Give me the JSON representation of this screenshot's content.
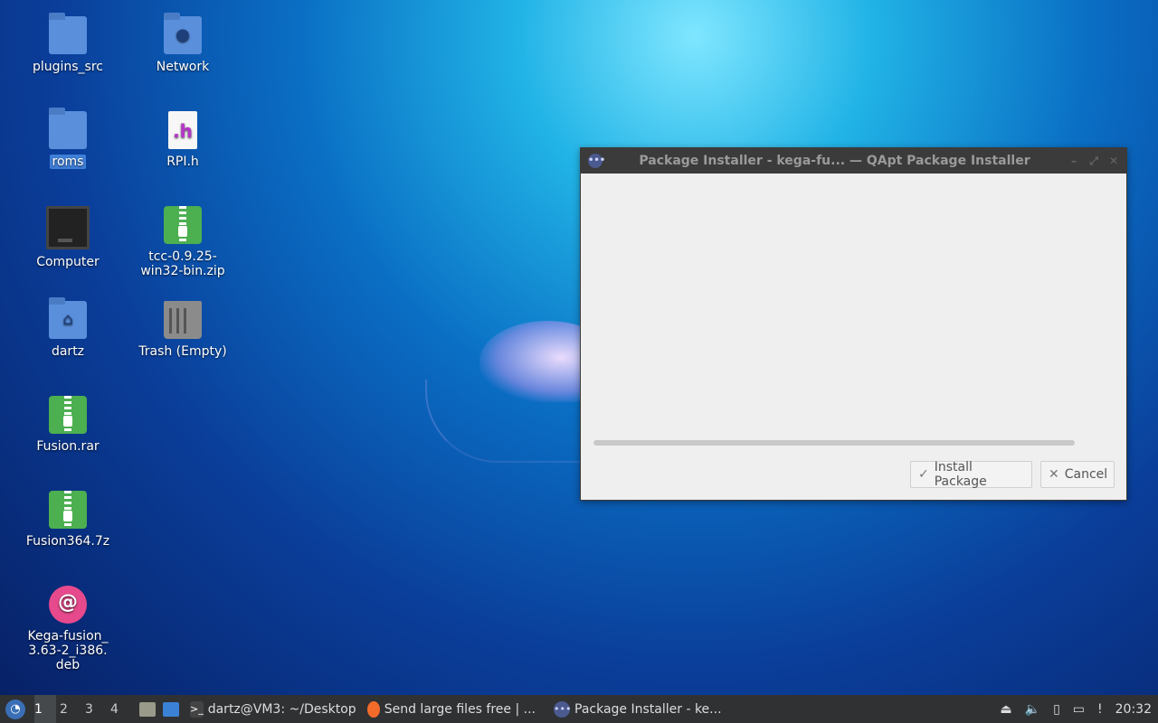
{
  "desktop": {
    "icons": [
      {
        "label": "plugins_src",
        "icon": "folder-icon"
      },
      {
        "label": "Network",
        "icon": "network-folder-icon"
      },
      {
        "label": "roms",
        "icon": "folder-icon"
      },
      {
        "label": "RPI.h",
        "icon": "c-header-file-icon"
      },
      {
        "label": "Computer",
        "icon": "computer-icon"
      },
      {
        "label": "tcc-0.9.25-win32-bin.zip",
        "icon": "zip-archive-icon"
      },
      {
        "label": "dartz",
        "icon": "home-folder-icon"
      },
      {
        "label": "Trash (Empty)",
        "icon": "trash-icon"
      },
      {
        "label": "Fusion.rar",
        "icon": "rar-archive-icon"
      },
      {
        "label": "Fusion364.7z",
        "icon": "7z-archive-icon"
      },
      {
        "label": "Kega-fusion_3.63-2_i386.deb",
        "icon": "debian-package-icon"
      }
    ]
  },
  "window": {
    "title": "Package Installer - kega-fu...  — QApt Package Installer",
    "install_label": "Install Package",
    "cancel_label": "Cancel",
    "progress": 0
  },
  "taskbar": {
    "workspaces": [
      "1",
      "2",
      "3",
      "4"
    ],
    "active_workspace": "1",
    "tasks": [
      {
        "label": "dartz@VM3: ~/Desktop",
        "icon": "terminal-icon"
      },
      {
        "label": "Send large files free | ...",
        "icon": "firefox-icon"
      },
      {
        "label": "Package Installer - ke...",
        "icon": "package-installer-icon"
      }
    ],
    "clock": "20:32"
  }
}
